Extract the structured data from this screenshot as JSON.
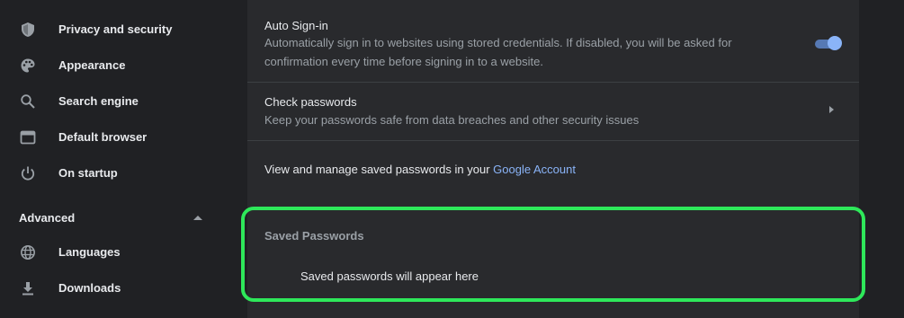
{
  "sidebar": {
    "items": [
      {
        "label": "Privacy and security",
        "icon": "shield-icon"
      },
      {
        "label": "Appearance",
        "icon": "palette-icon"
      },
      {
        "label": "Search engine",
        "icon": "search-icon"
      },
      {
        "label": "Default browser",
        "icon": "browser-window-icon"
      },
      {
        "label": "On startup",
        "icon": "power-icon"
      }
    ],
    "advanced": {
      "label": "Advanced",
      "icon": "caret-up-icon"
    },
    "advanced_items": [
      {
        "label": "Languages",
        "icon": "globe-icon"
      },
      {
        "label": "Downloads",
        "icon": "download-icon"
      }
    ]
  },
  "main": {
    "auto_signin": {
      "title": "Auto Sign-in",
      "description": "Automatically sign in to websites using stored credentials. If disabled, you will be asked for confirmation every time before signing in to a website.",
      "enabled": true
    },
    "check_passwords": {
      "title": "Check passwords",
      "description": "Keep your passwords safe from data breaches and other security issues"
    },
    "manage": {
      "text": "View and manage saved passwords in your ",
      "link": "Google Account"
    },
    "saved_passwords": {
      "header": "Saved Passwords",
      "empty_text": "Saved passwords will appear here"
    }
  },
  "colors": {
    "background": "#202124",
    "card": "#292a2d",
    "accent": "#8ab4f8",
    "highlight": "#2ee85a"
  }
}
